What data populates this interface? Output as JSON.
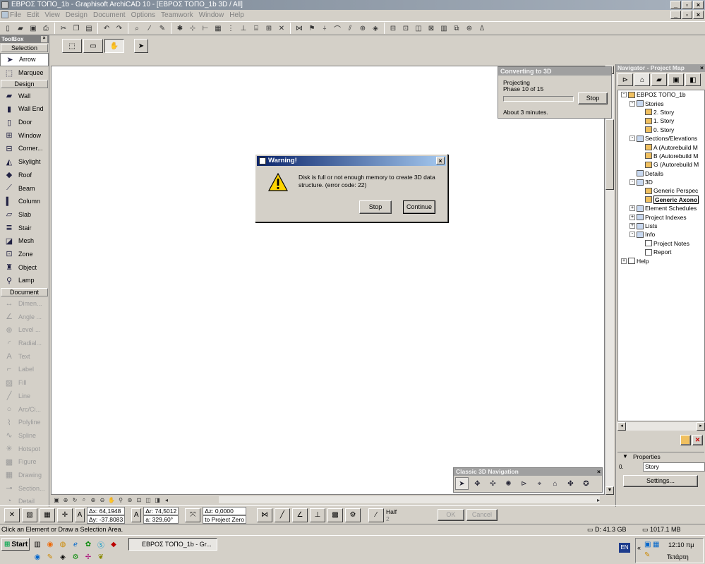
{
  "window": {
    "title": "ΕΒΡΟΣ ΤΟΠΟ_1b - Graphisoft ArchiCAD 10 - [ΕΒΡΟΣ ΤΟΠΟ_1b 3D / All]"
  },
  "menu": [
    "File",
    "Edit",
    "View",
    "Design",
    "Document",
    "Options",
    "Teamwork",
    "Window",
    "Help"
  ],
  "toolbox": {
    "title": "ToolBox",
    "sections": {
      "selection": "Selection",
      "design": "Design",
      "document": "Document"
    },
    "selection_tools": [
      "Arrow",
      "Marquee"
    ],
    "design_tools": [
      "Wall",
      "Wall End",
      "Door",
      "Window",
      "Corner...",
      "Skylight",
      "Roof",
      "Beam",
      "Column",
      "Slab",
      "Stair",
      "Mesh",
      "Zone",
      "Object",
      "Lamp"
    ],
    "document_tools": [
      "Dimen...",
      "Angle ...",
      "Level ...",
      "Radial...",
      "Text",
      "Label",
      "Fill",
      "Line",
      "Arc/Ci...",
      "Polyline",
      "Spline",
      "Hotspot",
      "Figure",
      "Drawing",
      "Section...",
      "Detail"
    ]
  },
  "converting": {
    "title": "Converting to 3D",
    "line1": "Projecting",
    "line2": "Phase 10 of 15",
    "progress": 0.0,
    "stop": "Stop",
    "estimate": "About   3 minutes."
  },
  "dialog": {
    "title": "Warning!",
    "message": "Disk is full or not enough memory to create 3D data structure. (error code: 22)",
    "stop": "Stop",
    "continue": "Continue"
  },
  "navigator": {
    "title": "Navigator - Project Map",
    "tree": [
      {
        "label": "ΕΒΡΟΣ ΤΟΠΟ_1b",
        "level": 0,
        "exp": "-"
      },
      {
        "label": "Stories",
        "level": 1,
        "exp": "-"
      },
      {
        "label": "2. Story",
        "level": 2,
        "exp": ""
      },
      {
        "label": "1. Story",
        "level": 2,
        "exp": ""
      },
      {
        "label": "0. Story",
        "level": 2,
        "exp": ""
      },
      {
        "label": "Sections/Elevations",
        "level": 1,
        "exp": "-"
      },
      {
        "label": "A (Autorebuild M",
        "level": 2,
        "exp": ""
      },
      {
        "label": "B (Autorebuild M",
        "level": 2,
        "exp": ""
      },
      {
        "label": "G (Autorebuild M",
        "level": 2,
        "exp": ""
      },
      {
        "label": "Details",
        "level": 1,
        "exp": ""
      },
      {
        "label": "3D",
        "level": 1,
        "exp": "-"
      },
      {
        "label": "Generic Perspec",
        "level": 2,
        "exp": ""
      },
      {
        "label": "Generic Axono",
        "level": 2,
        "exp": ""
      },
      {
        "label": "Element Schedules",
        "level": 1,
        "exp": "+"
      },
      {
        "label": "Project Indexes",
        "level": 1,
        "exp": "+"
      },
      {
        "label": "Lists",
        "level": 1,
        "exp": "+"
      },
      {
        "label": "Info",
        "level": 1,
        "exp": "-"
      },
      {
        "label": "Project Notes",
        "level": 2,
        "exp": ""
      },
      {
        "label": "Report",
        "level": 2,
        "exp": ""
      },
      {
        "label": "Help",
        "level": 0,
        "exp": "+"
      }
    ]
  },
  "properties": {
    "title": "Properties",
    "id": "0.",
    "value": "Story",
    "settings": "Settings..."
  },
  "nav3d": {
    "title": "Classic 3D Navigation"
  },
  "control": {
    "dx": "Δx: 64,1948",
    "dy": "Δy: -37,8083",
    "dr": "Δr: 74,5012",
    "angle": "a: 329,60°",
    "dz": "Δz: 0,0000",
    "ref": "to Project Zero",
    "half": "Half",
    "half_val": "2",
    "ok": "OK",
    "cancel": "Cancel"
  },
  "status": {
    "hint": "Click an Element or Draw a Selection Area.",
    "disk": "D: 41.3 GB",
    "mem": "1017.1 MB"
  },
  "taskbar": {
    "start": "Start",
    "task": "ΕΒΡΟΣ ΤΟΠΟ_1b - Gr...",
    "lang": "EN",
    "time": "12:10 πμ",
    "day": "Τετάρτη"
  }
}
